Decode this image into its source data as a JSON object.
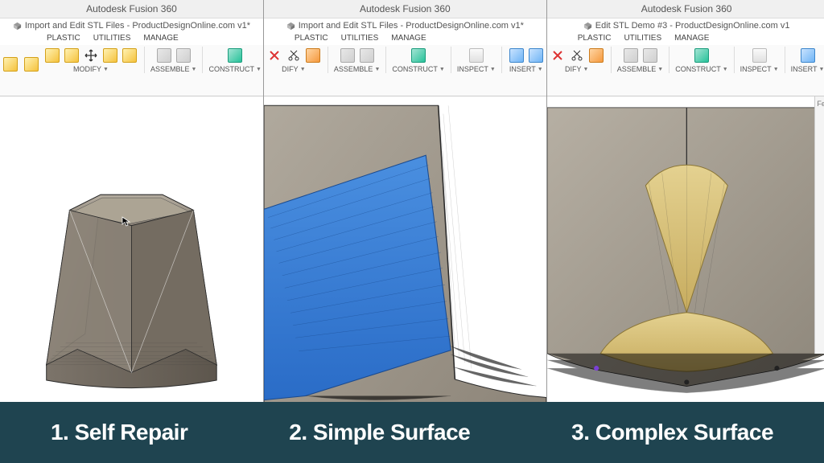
{
  "app_title": "Autodesk Fusion 360",
  "panels": [
    {
      "doc_title": "Import and Edit STL Files - ProductDesignOnline.com v1*"
    },
    {
      "doc_title": "Import and Edit STL Files - ProductDesignOnline.com v1*"
    },
    {
      "doc_title": "Edit STL Demo #3 - ProductDesignOnline.com v1"
    }
  ],
  "ribbon": {
    "tabs": [
      "PLASTIC",
      "UTILITIES",
      "MANAGE"
    ],
    "groups": {
      "modify": "MODIFY",
      "assemble": "ASSEMBLE",
      "construct": "CONSTRUCT",
      "inspect": "INSPECT",
      "insert": "INSERT"
    }
  },
  "captions": [
    "1. Self Repair",
    "2. Simple Surface",
    "3. Complex Surface"
  ],
  "side_panel_label": "Fe"
}
